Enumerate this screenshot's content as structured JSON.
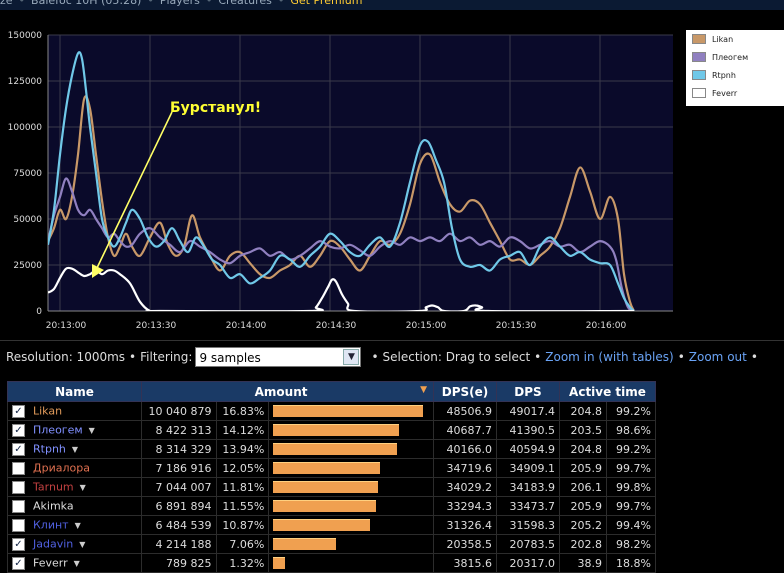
{
  "nav": {
    "items": [
      "ze",
      "Balefoc 10H (05:28)",
      "Players",
      "Creatures",
      "Get Premium"
    ]
  },
  "chart_data": {
    "type": "line",
    "xlabel": "",
    "ylabel": "",
    "ylim": [
      0,
      150000
    ],
    "xlim": [
      0,
      560
    ],
    "y_ticks": [
      "0",
      "25000",
      "50000",
      "75000",
      "100000",
      "125000",
      "150000"
    ],
    "x_ticks": [
      {
        "x": 0,
        "label": "20:13:00"
      },
      {
        "x": 90,
        "label": "20:13:30"
      },
      {
        "x": 180,
        "label": "20:14:00"
      },
      {
        "x": 270,
        "label": "20:14:30"
      },
      {
        "x": 360,
        "label": "20:15:00"
      },
      {
        "x": 450,
        "label": "20:15:30"
      },
      {
        "x": 540,
        "label": "20:16:00"
      }
    ],
    "grid": true,
    "legend_position": "right",
    "annotation": "Бурстанул!",
    "series": [
      {
        "name": "Likan",
        "color": "#c89868",
        "points": [
          [
            -12,
            38000
          ],
          [
            -6,
            45000
          ],
          [
            0,
            55000
          ],
          [
            6,
            50000
          ],
          [
            12,
            62000
          ],
          [
            18,
            85000
          ],
          [
            24,
            115000
          ],
          [
            30,
            110000
          ],
          [
            36,
            85000
          ],
          [
            42,
            60000
          ],
          [
            48,
            40000
          ],
          [
            54,
            30000
          ],
          [
            60,
            35000
          ],
          [
            66,
            42000
          ],
          [
            72,
            35000
          ],
          [
            80,
            30000
          ],
          [
            90,
            40000
          ],
          [
            100,
            48000
          ],
          [
            108,
            36000
          ],
          [
            116,
            30000
          ],
          [
            124,
            35000
          ],
          [
            132,
            52000
          ],
          [
            140,
            40000
          ],
          [
            150,
            30000
          ],
          [
            160,
            22000
          ],
          [
            170,
            30000
          ],
          [
            180,
            32000
          ],
          [
            190,
            26000
          ],
          [
            200,
            20000
          ],
          [
            210,
            18000
          ],
          [
            220,
            22000
          ],
          [
            230,
            25000
          ],
          [
            240,
            30000
          ],
          [
            250,
            24000
          ],
          [
            260,
            30000
          ],
          [
            270,
            38000
          ],
          [
            280,
            35000
          ],
          [
            290,
            28000
          ],
          [
            300,
            22000
          ],
          [
            310,
            30000
          ],
          [
            320,
            38000
          ],
          [
            330,
            36000
          ],
          [
            340,
            42000
          ],
          [
            350,
            58000
          ],
          [
            360,
            80000
          ],
          [
            370,
            85000
          ],
          [
            380,
            70000
          ],
          [
            390,
            58000
          ],
          [
            400,
            54000
          ],
          [
            410,
            60000
          ],
          [
            420,
            58000
          ],
          [
            430,
            48000
          ],
          [
            440,
            38000
          ],
          [
            450,
            28000
          ],
          [
            460,
            28000
          ],
          [
            470,
            25000
          ],
          [
            480,
            30000
          ],
          [
            490,
            35000
          ],
          [
            500,
            45000
          ],
          [
            510,
            62000
          ],
          [
            520,
            78000
          ],
          [
            530,
            65000
          ],
          [
            540,
            50000
          ],
          [
            550,
            62000
          ],
          [
            558,
            50000
          ],
          [
            564,
            20000
          ],
          [
            570,
            5000
          ],
          [
            574,
            0
          ]
        ]
      },
      {
        "name": "Плеогем",
        "color": "#9080c0",
        "points": [
          [
            -12,
            38000
          ],
          [
            -6,
            52000
          ],
          [
            0,
            62000
          ],
          [
            6,
            72000
          ],
          [
            12,
            65000
          ],
          [
            18,
            55000
          ],
          [
            24,
            52000
          ],
          [
            30,
            55000
          ],
          [
            36,
            50000
          ],
          [
            42,
            45000
          ],
          [
            48,
            40000
          ],
          [
            54,
            42000
          ],
          [
            60,
            38000
          ],
          [
            66,
            35000
          ],
          [
            72,
            36000
          ],
          [
            80,
            42000
          ],
          [
            90,
            45000
          ],
          [
            100,
            40000
          ],
          [
            110,
            36000
          ],
          [
            120,
            32000
          ],
          [
            130,
            38000
          ],
          [
            140,
            35000
          ],
          [
            150,
            32000
          ],
          [
            160,
            28000
          ],
          [
            170,
            26000
          ],
          [
            180,
            30000
          ],
          [
            190,
            32000
          ],
          [
            200,
            34000
          ],
          [
            210,
            30000
          ],
          [
            220,
            32000
          ],
          [
            230,
            28000
          ],
          [
            240,
            30000
          ],
          [
            250,
            34000
          ],
          [
            260,
            38000
          ],
          [
            270,
            35000
          ],
          [
            280,
            34000
          ],
          [
            290,
            36000
          ],
          [
            300,
            33000
          ],
          [
            310,
            30000
          ],
          [
            320,
            35000
          ],
          [
            330,
            38000
          ],
          [
            340,
            36000
          ],
          [
            350,
            40000
          ],
          [
            360,
            38000
          ],
          [
            370,
            40000
          ],
          [
            380,
            38000
          ],
          [
            390,
            42000
          ],
          [
            400,
            38000
          ],
          [
            410,
            40000
          ],
          [
            420,
            36000
          ],
          [
            430,
            38000
          ],
          [
            440,
            35000
          ],
          [
            450,
            40000
          ],
          [
            460,
            38000
          ],
          [
            470,
            34000
          ],
          [
            480,
            36000
          ],
          [
            490,
            38000
          ],
          [
            500,
            35000
          ],
          [
            510,
            36000
          ],
          [
            520,
            32000
          ],
          [
            530,
            35000
          ],
          [
            540,
            38000
          ],
          [
            550,
            35000
          ],
          [
            556,
            28000
          ],
          [
            562,
            12000
          ],
          [
            568,
            2000
          ],
          [
            574,
            0
          ]
        ]
      },
      {
        "name": "Rtpnh",
        "color": "#70c8e8",
        "points": [
          [
            -12,
            36000
          ],
          [
            -6,
            55000
          ],
          [
            0,
            85000
          ],
          [
            6,
            110000
          ],
          [
            12,
            128000
          ],
          [
            18,
            140000
          ],
          [
            22,
            137000
          ],
          [
            26,
            120000
          ],
          [
            30,
            100000
          ],
          [
            36,
            75000
          ],
          [
            42,
            50000
          ],
          [
            48,
            40000
          ],
          [
            54,
            35000
          ],
          [
            60,
            40000
          ],
          [
            66,
            48000
          ],
          [
            72,
            55000
          ],
          [
            80,
            50000
          ],
          [
            88,
            40000
          ],
          [
            96,
            35000
          ],
          [
            104,
            38000
          ],
          [
            112,
            45000
          ],
          [
            120,
            38000
          ],
          [
            128,
            32000
          ],
          [
            136,
            40000
          ],
          [
            144,
            35000
          ],
          [
            152,
            28000
          ],
          [
            160,
            25000
          ],
          [
            170,
            18000
          ],
          [
            180,
            20000
          ],
          [
            190,
            15000
          ],
          [
            200,
            18000
          ],
          [
            210,
            22000
          ],
          [
            220,
            30000
          ],
          [
            230,
            28000
          ],
          [
            240,
            24000
          ],
          [
            250,
            30000
          ],
          [
            260,
            35000
          ],
          [
            270,
            42000
          ],
          [
            280,
            38000
          ],
          [
            290,
            32000
          ],
          [
            300,
            30000
          ],
          [
            310,
            36000
          ],
          [
            320,
            40000
          ],
          [
            330,
            35000
          ],
          [
            340,
            48000
          ],
          [
            350,
            70000
          ],
          [
            360,
            90000
          ],
          [
            368,
            92000
          ],
          [
            376,
            82000
          ],
          [
            384,
            70000
          ],
          [
            392,
            45000
          ],
          [
            400,
            28000
          ],
          [
            410,
            24000
          ],
          [
            420,
            25000
          ],
          [
            430,
            22000
          ],
          [
            440,
            28000
          ],
          [
            450,
            30000
          ],
          [
            460,
            32000
          ],
          [
            470,
            25000
          ],
          [
            480,
            35000
          ],
          [
            490,
            40000
          ],
          [
            500,
            35000
          ],
          [
            510,
            30000
          ],
          [
            520,
            32000
          ],
          [
            530,
            28000
          ],
          [
            540,
            26000
          ],
          [
            550,
            25000
          ],
          [
            558,
            15000
          ],
          [
            564,
            7000
          ],
          [
            570,
            2000
          ],
          [
            574,
            0
          ]
        ]
      },
      {
        "name": "Feverr",
        "color": "#ffffff",
        "points": [
          [
            -12,
            10000
          ],
          [
            -6,
            12000
          ],
          [
            0,
            18000
          ],
          [
            6,
            23000
          ],
          [
            12,
            23000
          ],
          [
            18,
            21000
          ],
          [
            24,
            19000
          ],
          [
            30,
            20000
          ],
          [
            36,
            22000
          ],
          [
            42,
            20000
          ],
          [
            48,
            22000
          ],
          [
            54,
            22000
          ],
          [
            60,
            20000
          ],
          [
            70,
            15000
          ],
          [
            80,
            5000
          ],
          [
            90,
            0
          ],
          [
            100,
            0
          ],
          [
            250,
            0
          ],
          [
            256,
            2000
          ],
          [
            262,
            7000
          ],
          [
            268,
            13000
          ],
          [
            272,
            17000
          ],
          [
            276,
            16000
          ],
          [
            282,
            9000
          ],
          [
            288,
            4000
          ],
          [
            294,
            0
          ],
          [
            360,
            0
          ],
          [
            366,
            2000
          ],
          [
            372,
            3000
          ],
          [
            378,
            2000
          ],
          [
            384,
            0
          ],
          [
            404,
            0
          ],
          [
            410,
            2500
          ],
          [
            416,
            3000
          ],
          [
            422,
            2000
          ],
          [
            428,
            0
          ],
          [
            574,
            0
          ]
        ]
      }
    ]
  },
  "legend": [
    {
      "name": "Likan",
      "color": "#c89868"
    },
    {
      "name": "Плеогем",
      "color": "#9080c0"
    },
    {
      "name": "Rtpnh",
      "color": "#70c8e8"
    },
    {
      "name": "Feverr",
      "color": "#ffffff"
    }
  ],
  "controls": {
    "resolution": "Resolution: 1000ms",
    "filtering_label": "Filtering:",
    "filtering_value": "9 samples",
    "selection": "Selection: Drag to select",
    "zoom_in": "Zoom in (with tables)",
    "zoom_out": "Zoom out"
  },
  "table": {
    "headers": [
      "Name",
      "Amount",
      "DPS(e)",
      "DPS",
      "Active time"
    ],
    "rows": [
      {
        "name": "Likan",
        "name_color": "#e09a5a",
        "checked": true,
        "dropdown": false,
        "amount": "10 040 879",
        "pct": "16.83%",
        "bar": 1.0,
        "dpse": "48506.9",
        "dps": "49017.4",
        "time": "204.8",
        "active": "99.2%"
      },
      {
        "name": "Плеогем",
        "name_color": "#8090ff",
        "checked": true,
        "dropdown": true,
        "amount": "8 422 313",
        "pct": "14.12%",
        "bar": 0.839,
        "dpse": "40687.7",
        "dps": "41390.5",
        "time": "203.5",
        "active": "98.6%"
      },
      {
        "name": "Rtpnh",
        "name_color": "#8090ff",
        "checked": true,
        "dropdown": true,
        "amount": "8 314 329",
        "pct": "13.94%",
        "bar": 0.828,
        "dpse": "40166.0",
        "dps": "40594.9",
        "time": "204.8",
        "active": "99.2%"
      },
      {
        "name": "Дриалора",
        "name_color": "#e07050",
        "checked": false,
        "dropdown": false,
        "amount": "7 186 916",
        "pct": "12.05%",
        "bar": 0.716,
        "dpse": "34719.6",
        "dps": "34909.1",
        "time": "205.9",
        "active": "99.7%"
      },
      {
        "name": "Tarnum",
        "name_color": "#c04040",
        "checked": false,
        "dropdown": true,
        "amount": "7 044 007",
        "pct": "11.81%",
        "bar": 0.702,
        "dpse": "34029.2",
        "dps": "34183.9",
        "time": "206.1",
        "active": "99.8%"
      },
      {
        "name": "Akimka",
        "name_color": "#dddddd",
        "checked": false,
        "dropdown": false,
        "amount": "6 891 894",
        "pct": "11.55%",
        "bar": 0.686,
        "dpse": "33294.3",
        "dps": "33473.7",
        "time": "205.9",
        "active": "99.7%"
      },
      {
        "name": "Клинт",
        "name_color": "#5060e0",
        "checked": false,
        "dropdown": true,
        "amount": "6 484 539",
        "pct": "10.87%",
        "bar": 0.646,
        "dpse": "31326.4",
        "dps": "31598.3",
        "time": "205.2",
        "active": "99.4%"
      },
      {
        "name": "Jadavin",
        "name_color": "#5060e0",
        "checked": true,
        "dropdown": true,
        "amount": "4 214 188",
        "pct": "7.06%",
        "bar": 0.42,
        "dpse": "20358.5",
        "dps": "20783.5",
        "time": "202.8",
        "active": "98.2%"
      },
      {
        "name": "Feverr",
        "name_color": "#dddddd",
        "checked": true,
        "dropdown": true,
        "amount": "789 825",
        "pct": "1.32%",
        "bar": 0.079,
        "dpse": "3815.6",
        "dps": "20317.0",
        "time": "38.9",
        "active": "18.8%"
      }
    ]
  }
}
